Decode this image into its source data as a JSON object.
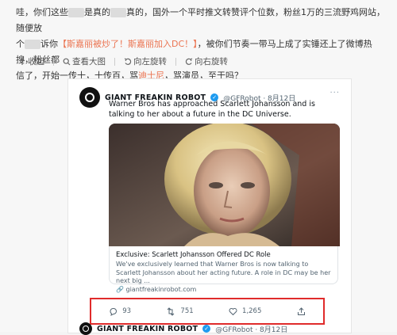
{
  "post": {
    "text_line1_a": "哇，你们这些",
    "text_line1_b": "是真的",
    "text_line1_c": "真的，国外一个平时推文转赞评个位数，粉丝1万的三流野鸡网站，随便放",
    "text_line2_a": "个",
    "text_line2_b": "诉你",
    "text_line2_hl1": "【斯嘉丽被炒了！斯嘉丽加入DC！】",
    "text_line2_c": "，被你们节奏一带马上成了实锤还上了微博热搜，粉丝都",
    "text_line3_a": "信了，开始一传十，十传百，骂",
    "text_line3_hl": "迪士尼",
    "text_line3_b": "，骂演员，至于吗？"
  },
  "actions": [
    {
      "icon": "bookmark-icon",
      "label": "收起"
    },
    {
      "icon": "zoom-icon",
      "label": "查看大图"
    },
    {
      "icon": "rotate-left-icon",
      "label": "向左旋转"
    },
    {
      "icon": "rotate-right-icon",
      "label": "向右旋转"
    }
  ],
  "tweet": {
    "account_name": "GIANT FREAKIN ROBOT",
    "handle_date": "@GFRobot · 8月12日",
    "more": "···",
    "text": "Warner Bros has approached Scarlett Johansson and is talking to her about a future in the DC Universe.",
    "link_title": "Exclusive: Scarlett Johansson Offered DC Role",
    "link_desc": "We've exclusively learned that Warner Bros is now talking to Scarlett Johansson about her acting future. A role in DC may be her next big ...",
    "link_url": "🔗 giantfreakinrobot.com",
    "stats": {
      "replies": "93",
      "retweets": "751",
      "likes": "1,265"
    }
  },
  "tweet2": {
    "account_name": "GIANT FREAKIN ROBOT",
    "handle_date": "@GFRobot · 8月12日"
  },
  "colors": {
    "highlight": "#eb7350",
    "verified": "#1d9bf0",
    "annotation_box": "#e02b2b"
  }
}
